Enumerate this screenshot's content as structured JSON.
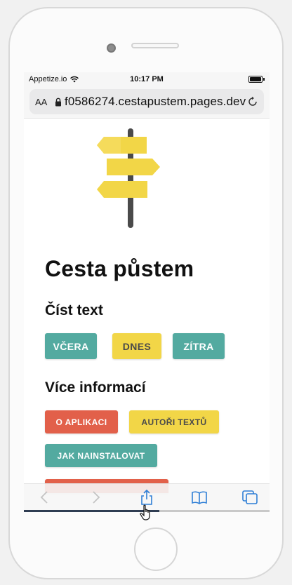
{
  "status_bar": {
    "carrier": "Appetize.io",
    "time": "10:17 PM"
  },
  "url_bar": {
    "text_size_label": "AA",
    "url": "f0586274.cestapustem.pages.dev"
  },
  "page": {
    "title": "Cesta půstem",
    "read_section": {
      "heading": "Číst text",
      "buttons": [
        "VČERA",
        "DNES",
        "ZÍTRA"
      ]
    },
    "info_section": {
      "heading": "Více informací",
      "buttons": [
        "O APLIKACI",
        "AUTOŘI TEXTŮ",
        "JAK NAINSTALOVAT"
      ]
    }
  },
  "toolbar": {
    "icons": [
      "back-icon",
      "forward-icon",
      "share-icon",
      "bookmarks-icon",
      "tabs-icon"
    ]
  },
  "colors": {
    "teal": "#53aaa0",
    "yellow": "#f2d647",
    "red": "#e2604a",
    "ios_blue": "#2f7fd6"
  },
  "page_load_progress": 0.55
}
